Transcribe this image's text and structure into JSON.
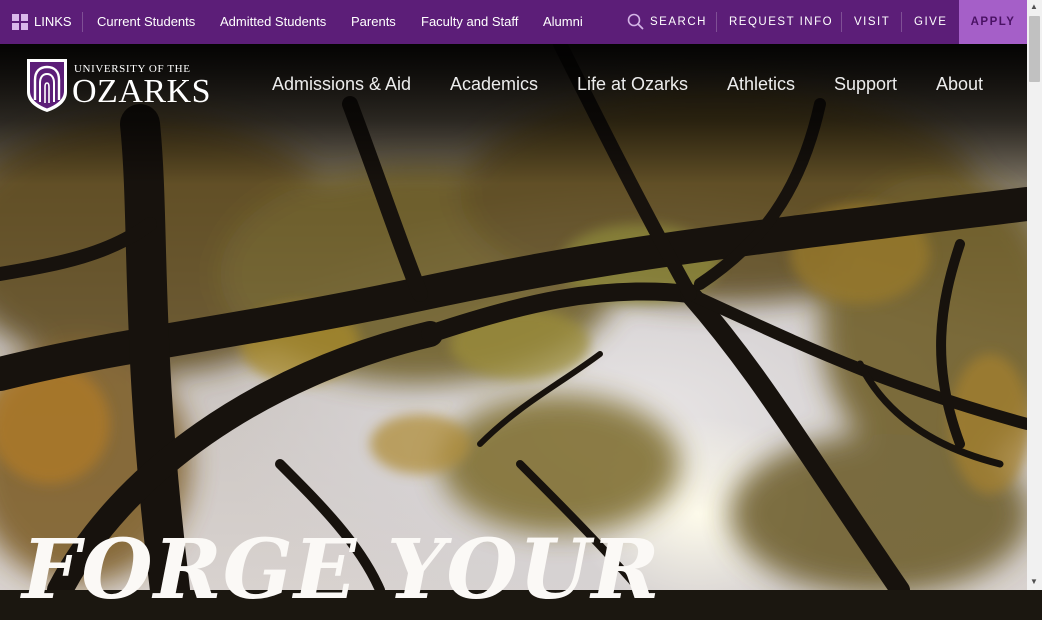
{
  "topbar": {
    "links_label": "LINKS",
    "items": [
      "Current Students",
      "Admitted Students",
      "Parents",
      "Faculty and Staff",
      "Alumni"
    ],
    "search_label": "SEARCH",
    "request_info": "REQUEST INFO",
    "visit": "VISIT",
    "give": "GIVE",
    "apply": "APPLY"
  },
  "logo": {
    "line1": "UNIVERSITY OF THE",
    "line2": "OZARKS"
  },
  "nav": [
    "Admissions & Aid",
    "Academics",
    "Life at Ozarks",
    "Athletics",
    "Support",
    "About"
  ],
  "hero": {
    "headline": "FORGE YOUR"
  },
  "colors": {
    "primary_purple": "#5c1e78",
    "apply_purple": "#a55fc8",
    "apply_text": "#4a1264"
  },
  "icons": {
    "links": "grid-icon",
    "search": "search-icon",
    "logo": "shield-arch-icon"
  }
}
